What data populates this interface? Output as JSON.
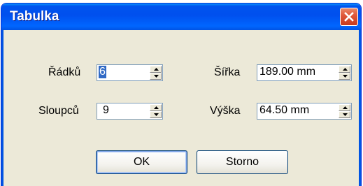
{
  "window": {
    "title": "Tabulka",
    "close_icon": "close-icon"
  },
  "fields": {
    "rows_label": "Řádků",
    "rows_value": "6",
    "cols_label": "Sloupců",
    "cols_value": "9",
    "width_label": "Šířka",
    "width_value": "189.00 mm",
    "height_label": "Výška",
    "height_value": "64.50 mm"
  },
  "buttons": {
    "ok_label": "OK",
    "cancel_label": "Storno"
  },
  "colors": {
    "titlebar": "#0054e3",
    "face": "#ece9d8",
    "selection": "#316ac5"
  }
}
